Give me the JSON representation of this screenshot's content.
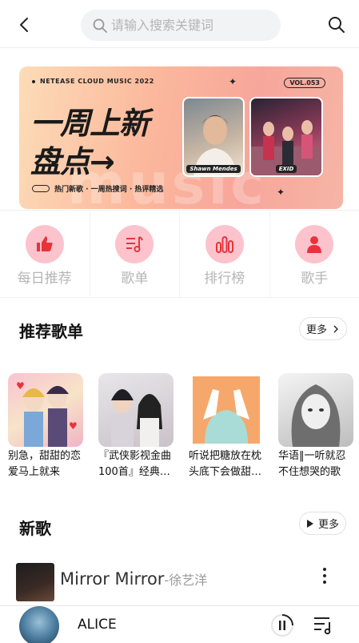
{
  "header": {
    "search_placeholder": "请输入搜索关键词"
  },
  "banner": {
    "brand": "NETEASE CLOUD MUSIC 2022",
    "vol": "VOL.053",
    "title_line1": "一周上新",
    "title_line2": "盘点→",
    "tags": "热门新歌 · 一周热搜词 · 热评精选",
    "card1_label": "Shawn Mendes",
    "card2_label": "EXID",
    "watermark": "music"
  },
  "quicknav": [
    {
      "label": "每日推荐",
      "icon": "thumb-up-icon"
    },
    {
      "label": "歌单",
      "icon": "playlist-icon"
    },
    {
      "label": "排行榜",
      "icon": "chart-bars-icon"
    },
    {
      "label": "歌手",
      "icon": "singer-icon"
    }
  ],
  "recommended": {
    "title": "推荐歌单",
    "more": "更多",
    "playlists": [
      {
        "name": "别急，甜甜的恋爱马上就来"
      },
      {
        "name": "『武侠影视金曲100首』经典回忆"
      },
      {
        "name": "听说把糖放在枕头底下会做甜甜的梦"
      },
      {
        "name": "华语‖一听就忍不住想哭的歌"
      }
    ]
  },
  "new_songs": {
    "title": "新歌",
    "more": "更多",
    "songs": [
      {
        "title": "Mirror Mirror",
        "artist": "-徐艺洋"
      }
    ]
  },
  "player": {
    "title": "ALICE"
  },
  "colors": {
    "accent": "#e8333b",
    "icon_circle": "#fcc3cc"
  }
}
